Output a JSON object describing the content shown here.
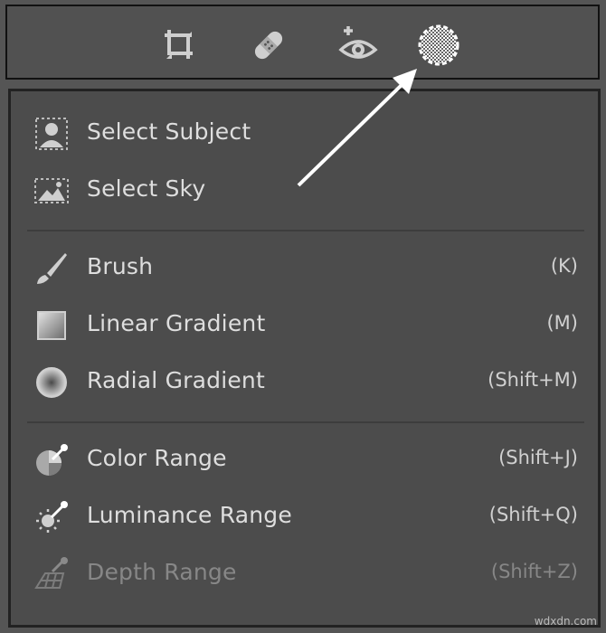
{
  "toolbar": {
    "tools": [
      {
        "icon": "crop-icon",
        "active": false
      },
      {
        "icon": "healing-bandage-icon",
        "active": false
      },
      {
        "icon": "red-eye-icon",
        "active": false
      },
      {
        "icon": "masking-icon",
        "active": true
      }
    ]
  },
  "menu": {
    "groups": [
      {
        "items": [
          {
            "label": "Select Subject",
            "shortcut": "",
            "icon": "select-subject-icon",
            "enabled": true
          },
          {
            "label": "Select Sky",
            "shortcut": "",
            "icon": "select-sky-icon",
            "enabled": true
          }
        ]
      },
      {
        "items": [
          {
            "label": "Brush",
            "shortcut": "(K)",
            "icon": "brush-icon",
            "enabled": true
          },
          {
            "label": "Linear Gradient",
            "shortcut": "(M)",
            "icon": "linear-gradient-icon",
            "enabled": true
          },
          {
            "label": "Radial Gradient",
            "shortcut": "(Shift+M)",
            "icon": "radial-gradient-icon",
            "enabled": true
          }
        ]
      },
      {
        "items": [
          {
            "label": "Color Range",
            "shortcut": "(Shift+J)",
            "icon": "color-range-icon",
            "enabled": true
          },
          {
            "label": "Luminance Range",
            "shortcut": "(Shift+Q)",
            "icon": "luminance-range-icon",
            "enabled": true
          },
          {
            "label": "Depth Range",
            "shortcut": "(Shift+Z)",
            "icon": "depth-range-icon",
            "enabled": false
          }
        ]
      }
    ]
  },
  "annotation": {
    "type": "arrow",
    "points_to": "masking-icon",
    "color": "#ffffff"
  },
  "watermark": {
    "text": "wdxdn.com"
  },
  "colors": {
    "background": "#555555",
    "panel": "#4c4c4c",
    "text": "#dedede",
    "disabled_text": "#878787"
  }
}
